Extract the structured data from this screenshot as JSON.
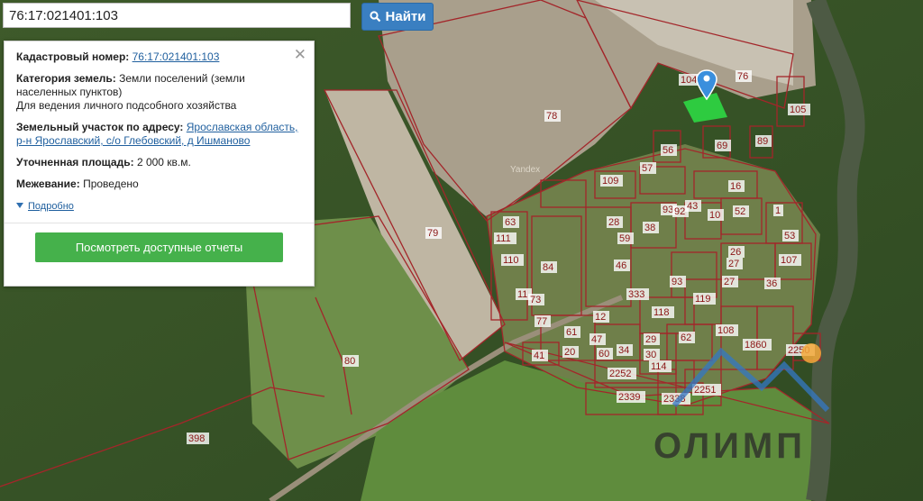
{
  "search": {
    "value": "76:17:021401:103",
    "button_label": "Найти"
  },
  "info_panel": {
    "cadastral_label": "Кадастровый номер:",
    "cadastral_number": "76:17:021401:103",
    "category_label": "Категория земель:",
    "category_value_1": "Земли поселений (земли",
    "category_value_2": "населенных пунктов)",
    "usage": "Для ведения личного подсобного хозяйства",
    "address_label": "Земельный участок по адресу:",
    "address_1": "Ярославская область,",
    "address_2": "р-н Ярославский, с/о Глебовский, д Ишманово",
    "area_label": "Уточненная площадь:",
    "area_value": "2 000 кв.м.",
    "survey_label": "Межевание:",
    "survey_value": "Проведено",
    "more_link": "Подробно",
    "reports_button": "Посмотреть доступные отчеты"
  },
  "map": {
    "provider_label": "Yandex",
    "watermark": "ОЛИМП",
    "selected_parcel": "103",
    "parcel_labels": [
      "104",
      "76",
      "105",
      "78",
      "56",
      "69",
      "89",
      "57",
      "109",
      "16",
      "52",
      "1",
      "53",
      "93",
      "92",
      "43",
      "10",
      "63",
      "28",
      "59",
      "38",
      "27",
      "111",
      "46",
      "26",
      "107",
      "110",
      "84",
      "27",
      "36",
      "333",
      "93",
      "11",
      "73",
      "119",
      "118",
      "77",
      "12",
      "61",
      "62",
      "108",
      "1860",
      "29",
      "47",
      "41",
      "20",
      "60",
      "34",
      "30",
      "114",
      "2252",
      "2250",
      "2339",
      "2338",
      "2251",
      "80",
      "79",
      "398"
    ]
  },
  "icons": {
    "search": "magnifier-icon",
    "marker": "map-marker-icon",
    "close": "close-icon"
  }
}
